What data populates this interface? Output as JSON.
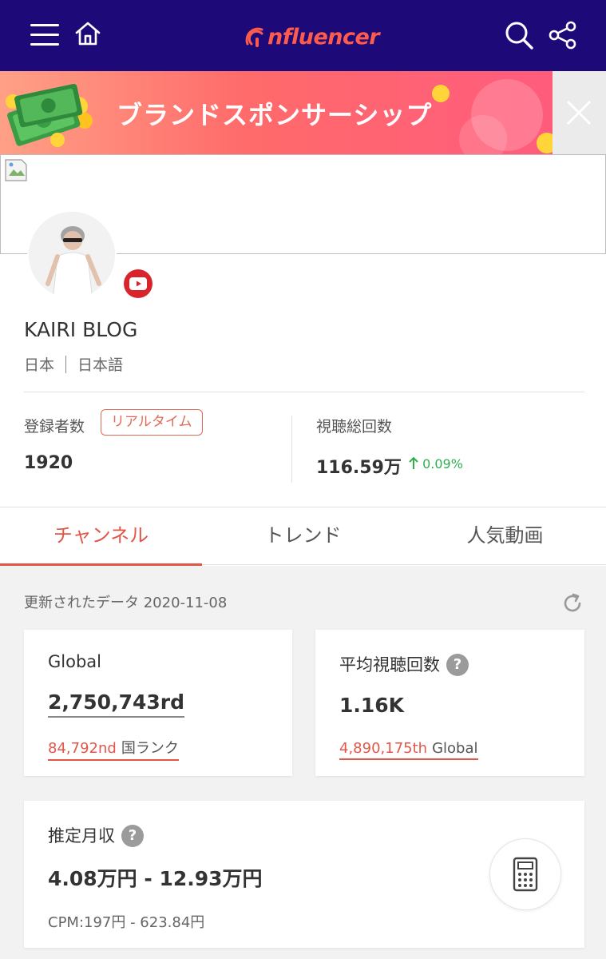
{
  "header": {
    "logo_text": "nfluencer",
    "icons": [
      "menu-icon",
      "home-icon",
      "search-icon",
      "share-icon"
    ]
  },
  "banner": {
    "text": "ブランドスポンサーシップ"
  },
  "profile": {
    "name": "KAIRI BLOG",
    "country": "日本",
    "language": "日本語",
    "platform": "youtube"
  },
  "stats": {
    "subscribers_label": "登録者数",
    "realtime_badge": "リアルタイム",
    "subscribers_value": "1920",
    "views_label": "視聴総回数",
    "views_value": "116.59万",
    "views_growth": "0.09%"
  },
  "tabs": [
    {
      "label": "チャンネル",
      "active": true
    },
    {
      "label": "トレンド",
      "active": false
    },
    {
      "label": "人気動画",
      "active": false
    }
  ],
  "channel": {
    "updated_label": "更新されたデータ 2020-11-08",
    "global_card": {
      "title": "Global",
      "rank": "2,750,743rd",
      "sub_rank": "84,792nd",
      "sub_rank_label": "国ランク"
    },
    "avg_views_card": {
      "title": "平均視聴回数",
      "value": "1.16K",
      "sub_rank": "4,890,175th",
      "sub_rank_label": "Global"
    },
    "income_card": {
      "title": "推定月収",
      "value": "4.08万円 - 12.93万円",
      "cpm": "CPM:197円 - 623.84円"
    }
  },
  "colors": {
    "nav_bg": "#1d0a78",
    "brand": "#ff5b4c",
    "accent": "#e0574a",
    "growth": "#2fae4e",
    "youtube": "#d8252c"
  }
}
